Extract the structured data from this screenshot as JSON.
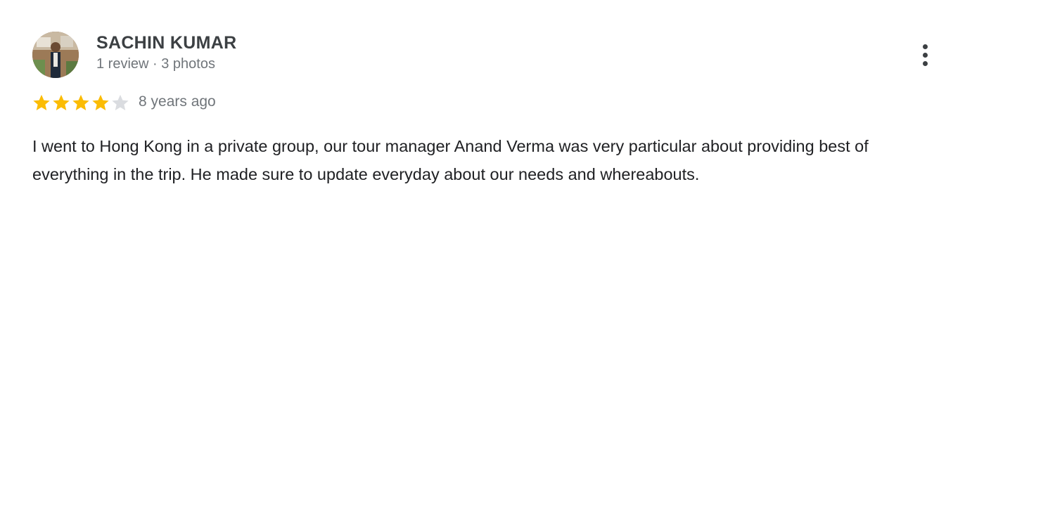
{
  "review": {
    "reviewer": {
      "name": "SACHIN KUMAR",
      "meta": "1 review · 3 photos",
      "avatar": "reviewer-avatar-photo"
    },
    "rating": {
      "value": 4,
      "max": 5,
      "filled_color": "#fbbc04",
      "empty_color": "#dadce0"
    },
    "time": "8 years ago",
    "text": "I went to Hong Kong in a private group, our tour manager Anand Verma was very particular about providing best of everything in the trip. He made sure to update everyday about our needs and whereabouts.",
    "menu_icon": "more-vert-icon"
  }
}
